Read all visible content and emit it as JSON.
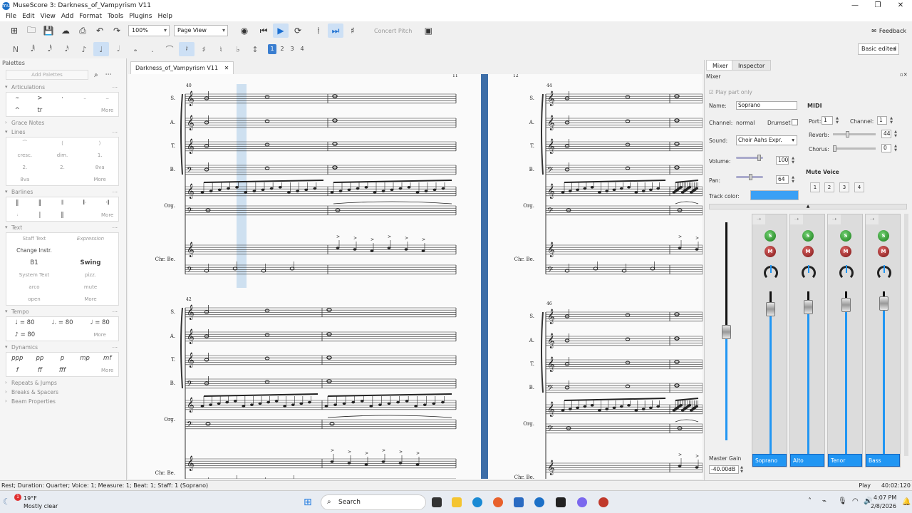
{
  "app": {
    "logo_text": "mu",
    "title": "MuseScore 3: Darkness_of_Vampyrism V11"
  },
  "window_controls": {
    "minimize": "—",
    "maximize": "❐",
    "close": "✕"
  },
  "menu": [
    "File",
    "Edit",
    "View",
    "Add",
    "Format",
    "Tools",
    "Plugins",
    "Help"
  ],
  "toolbar": {
    "zoom": "100%",
    "view_mode": "Page View",
    "concert_pitch": "Concert Pitch",
    "feedback": "Feedback",
    "workspace": "Basic edited"
  },
  "note_input": {
    "voices": [
      "1",
      "2",
      "3",
      "4"
    ]
  },
  "palettes": {
    "title": "Palettes",
    "add_button": "Add Palettes",
    "sections": {
      "articulations": "Articulations",
      "grace_notes": "Grace Notes",
      "lines": "Lines",
      "barlines": "Barlines",
      "text": "Text",
      "tempo": "Tempo",
      "dynamics": "Dynamics",
      "repeats": "Repeats & Jumps",
      "breaks": "Breaks & Spacers",
      "beam": "Beam Properties"
    },
    "articulation_cells": [
      "𝄐",
      ">",
      "·",
      "–",
      "⌢",
      "^",
      "tr",
      "",
      "",
      "More"
    ],
    "line_cells": [
      "⁀",
      "⟨",
      "⟩",
      "cresc.",
      "dim.",
      "1.",
      "2.",
      "2.",
      "8va",
      "8va",
      "",
      "More"
    ],
    "text_cells": [
      "Staff Text",
      "Expression",
      "Change Instr.",
      "",
      "B1",
      "Swing",
      "System Text",
      "pizz.",
      "arco",
      "mute",
      "open",
      "More"
    ],
    "tempo_cells": [
      "♩ = 80",
      "♩. = 80",
      "♩ = 80",
      "♪ = 80",
      "",
      "More"
    ],
    "dynamics_cells": [
      "ppp",
      "pp",
      "p",
      "mp",
      "mf",
      "f",
      "ff",
      "fff",
      "",
      "More"
    ],
    "more": "More"
  },
  "score_tab": {
    "label": "Darkness_of_Vampyrism V11",
    "close": "✕"
  },
  "score": {
    "measure_numbers": [
      "40",
      "44",
      "42",
      "46"
    ],
    "system1_labels": [
      "S.",
      "A.",
      "T.",
      "B.",
      "Org.",
      "Chr. Be."
    ],
    "system2_labels": [
      "S.",
      "A.",
      "T.",
      "B.",
      "Org.",
      "Chr. Be."
    ],
    "right_labels": [
      "S.",
      "A.",
      "T.",
      "B.",
      "Org.",
      "Chr. Be."
    ],
    "top_marks": [
      "11",
      "12"
    ]
  },
  "right_panel": {
    "tabs": [
      "Mixer",
      "Inspector"
    ],
    "mixer_title": "Mixer",
    "play_part_only": "Play part only",
    "name_label": "Name:",
    "name_value": "Soprano",
    "channel_label": "Channel:",
    "channel_value": "normal",
    "drumset_label": "Drumset",
    "sound_label": "Sound:",
    "sound_value": "Choir Aahs Expr.",
    "volume_label": "Volume:",
    "volume_value": "100",
    "pan_label": "Pan:",
    "pan_value": "64",
    "track_color_label": "Track color:",
    "track_color": "#3aa0f5",
    "midi_title": "MIDI",
    "port_label": "Port:",
    "port_value": "1",
    "midi_channel_label": "Channel:",
    "midi_channel_value": "1",
    "reverb_label": "Reverb:",
    "reverb_value": "44",
    "chorus_label": "Chorus:",
    "chorus_value": "0",
    "mute_voice_title": "Mute Voice",
    "mute_voices": [
      "1",
      "2",
      "3",
      "4"
    ],
    "master_gain_label": "Master Gain",
    "master_gain_value": "-40.00dB",
    "strips": [
      {
        "name": "Soprano",
        "level": 0.45
      },
      {
        "name": "Alto",
        "level": 0.5
      },
      {
        "name": "Tenor",
        "level": 0.55
      },
      {
        "name": "Bass",
        "level": 0.58
      }
    ],
    "solo_label": "S",
    "mute_label": "M"
  },
  "status": {
    "left": "Rest; Duration: Quarter; Voice: 1;  Measure: 1; Beat: 1; Staff: 1 (Soprano)",
    "mode": "Play",
    "position": "40:02:120"
  },
  "taskbar": {
    "weather_temp": "19°F",
    "weather_desc": "Mostly clear",
    "search": "Search",
    "time": "4:07 PM",
    "date": "2/8/2026",
    "badge": "1"
  },
  "colors": {
    "accent": "#2196f3",
    "selection": "#3a7ed0"
  }
}
